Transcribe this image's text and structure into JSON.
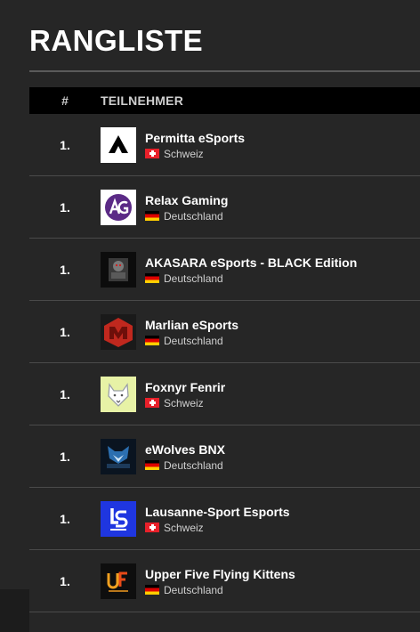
{
  "page": {
    "title": "RANGLISTE"
  },
  "table": {
    "headers": {
      "rank": "#",
      "participant": "TEILNEHMER"
    },
    "rows": [
      {
        "rank": "1.",
        "name": "Permitta eSports",
        "country": "Schweiz",
        "flag": "ch",
        "logo_icon": "permitta-logo-icon"
      },
      {
        "rank": "1.",
        "name": "Relax Gaming",
        "country": "Deutschland",
        "flag": "de",
        "logo_icon": "relax-gaming-logo-icon"
      },
      {
        "rank": "1.",
        "name": "AKASARA eSports - BLACK Edition",
        "country": "Deutschland",
        "flag": "de",
        "logo_icon": "akasara-logo-icon"
      },
      {
        "rank": "1.",
        "name": "Marlian eSports",
        "country": "Deutschland",
        "flag": "de",
        "logo_icon": "marlian-logo-icon"
      },
      {
        "rank": "1.",
        "name": "Foxnyr Fenrir",
        "country": "Schweiz",
        "flag": "ch",
        "logo_icon": "fenrir-wolf-logo-icon"
      },
      {
        "rank": "1.",
        "name": "eWolves BNX",
        "country": "Deutschland",
        "flag": "de",
        "logo_icon": "ewolves-logo-icon"
      },
      {
        "rank": "1.",
        "name": "Lausanne-Sport Esports",
        "country": "Schweiz",
        "flag": "ch",
        "logo_icon": "lausanne-sport-logo-icon"
      },
      {
        "rank": "1.",
        "name": "Upper Five Flying Kittens",
        "country": "Deutschland",
        "flag": "de",
        "logo_icon": "upper-five-logo-icon"
      }
    ]
  },
  "colors": {
    "background": "#262626",
    "header_bar": "#000000",
    "divider": "#4a4a4a"
  }
}
